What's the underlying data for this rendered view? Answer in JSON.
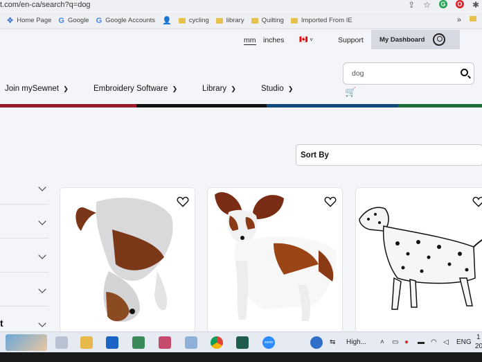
{
  "browser": {
    "url": "t.com/en-ca/search?q=dog",
    "bookmarks": [
      {
        "label": "Home Page",
        "icon": "apps-icon"
      },
      {
        "label": "Google",
        "icon": "google-icon"
      },
      {
        "label": "Google Accounts",
        "icon": "google-icon"
      },
      {
        "label": "",
        "icon": "person-icon"
      },
      {
        "label": "cycling",
        "icon": "folder-icon"
      },
      {
        "label": "library",
        "icon": "folder-icon"
      },
      {
        "label": "Quilting",
        "icon": "folder-icon"
      },
      {
        "label": "Imported From IE",
        "icon": "folder-icon"
      }
    ],
    "more_label": "»"
  },
  "utility": {
    "unit_mm": "mm",
    "unit_inches": "inches",
    "country": "🇨🇦",
    "support": "Support",
    "dashboard": "My Dashboard"
  },
  "search": {
    "value": "dog"
  },
  "nav": {
    "items": [
      "Join mySewnet",
      "Embroidery Software",
      "Library",
      "Studio"
    ]
  },
  "sort": {
    "label": "Sort By"
  },
  "filters": {
    "partial_text": "t"
  },
  "taskbar": {
    "text": "High...",
    "lang": "ENG",
    "clock_a": "1",
    "clock_b": "20",
    "zoom_label": "zoom"
  },
  "colors": {
    "stripe": [
      "#9b1d2c",
      "#111111",
      "#0f4a7a",
      "#1f6e3a"
    ],
    "dashboard_bg": "#d6d9e2"
  }
}
